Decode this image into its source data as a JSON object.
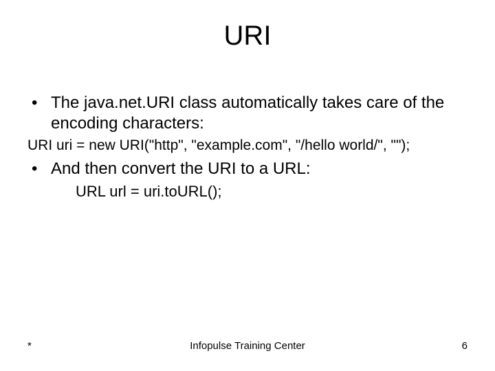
{
  "title": "URI",
  "bullets": [
    {
      "text": "The java.net.URI class automatically takes care of the encoding characters:",
      "code": "URI uri = new URI(\"http\", \"example.com\", \"/hello world/\", \"\");",
      "code_class": "code1"
    },
    {
      "text": "And then convert the URI to a URL:",
      "code": "URL url = uri.toURL();",
      "code_class": "code2"
    }
  ],
  "footer": {
    "left": "*",
    "center": "Infopulse Training Center",
    "right": "6"
  }
}
